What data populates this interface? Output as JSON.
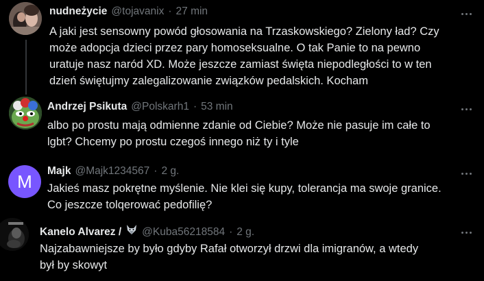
{
  "tweets": [
    {
      "name": "nudneżycie",
      "handle": "@tojavanix",
      "sep": "·",
      "time": "27 min",
      "body": "A jaki jest sensowny powód głosowania na Trzaskowskiego? Zielony ład? Czy\nmoże adopcja dzieci przez pary homoseksualne. O tak Panie to na pewno\nuratuje nasz naród XD. Może jeszcze zamiast święta niepodległości to w ten\ndzień świętujmy zalegalizowanie związków pedalskich. Kocham",
      "avatar_icon": "profile-photo"
    },
    {
      "name": "Andrzej Psikuta",
      "handle": "@Polskarh1",
      "sep": "·",
      "time": "53 min",
      "body": "albo po prostu mają odmienne zdanie od Ciebie? Może nie pasuje im całe to\nlgbt? Chcemy po prostu czegoś innego niż ty i tyle",
      "avatar_icon": "pepe-clown-avatar"
    },
    {
      "name": "Majk",
      "handle": "@Majk1234567",
      "sep": "·",
      "time": "2 g.",
      "body": "Jakieś masz pokrętne myślenie. Nie klei się kupy, tolerancja ma swoje granice.\nCo jeszcze tolqerować pedofilię?",
      "avatar_letter": "M",
      "avatar_color": "#7856ff"
    },
    {
      "name": "Kanelo Alvarez /",
      "handle": "@Kuba56218584",
      "sep": "·",
      "time": "2 g.",
      "body": "Najzabawniejsze by było gdyby Rafał otworzył drzwi dla imigranów, a wtedy\nbył by skowyt",
      "name_emoji": "wolf-emoji",
      "avatar_icon": "dark-photo-avatar"
    }
  ],
  "colors": {
    "background": "#000000",
    "text": "#e7e9ea",
    "secondary": "#71767b",
    "thread_line": "#333639"
  }
}
